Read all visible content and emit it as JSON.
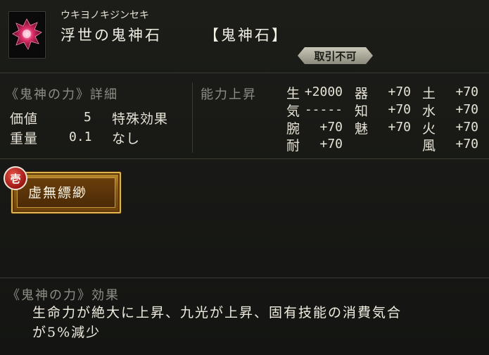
{
  "item": {
    "furigana": "ウキヨノキジンセキ",
    "name": "浮世の鬼神石",
    "type": "【鬼神石】",
    "trade_status": "取引不可"
  },
  "details": {
    "title": "《鬼神の力》詳細",
    "value_label": "価値",
    "value": "5",
    "weight_label": "重量",
    "weight": "0.1",
    "special_label": "特殊効果",
    "special_value": "なし"
  },
  "abilities": {
    "title": "能力上昇",
    "items": [
      {
        "key": "生",
        "value": "+2000"
      },
      {
        "key": "器",
        "value": "+70"
      },
      {
        "key": "土",
        "value": "+70"
      },
      {
        "key": "気",
        "value": "-----"
      },
      {
        "key": "知",
        "value": "+70"
      },
      {
        "key": "水",
        "value": "+70"
      },
      {
        "key": "腕",
        "value": "+70"
      },
      {
        "key": "魅",
        "value": "+70"
      },
      {
        "key": "火",
        "value": "+70"
      },
      {
        "key": "耐",
        "value": "+70"
      },
      {
        "key": "風",
        "value": "+70"
      }
    ]
  },
  "skill": {
    "rank": "壱",
    "name": "虚無縹緲"
  },
  "effect": {
    "title": "《鬼神の力》効果",
    "line1": "生命力が絶大に上昇、九光が上昇、固有技能の消費気合",
    "line2": "が5%減少"
  },
  "colors": {
    "background": "#151613",
    "gem": "#e0306a",
    "skill_gold": "#e0b44e",
    "badge_red": "#c4241d"
  }
}
